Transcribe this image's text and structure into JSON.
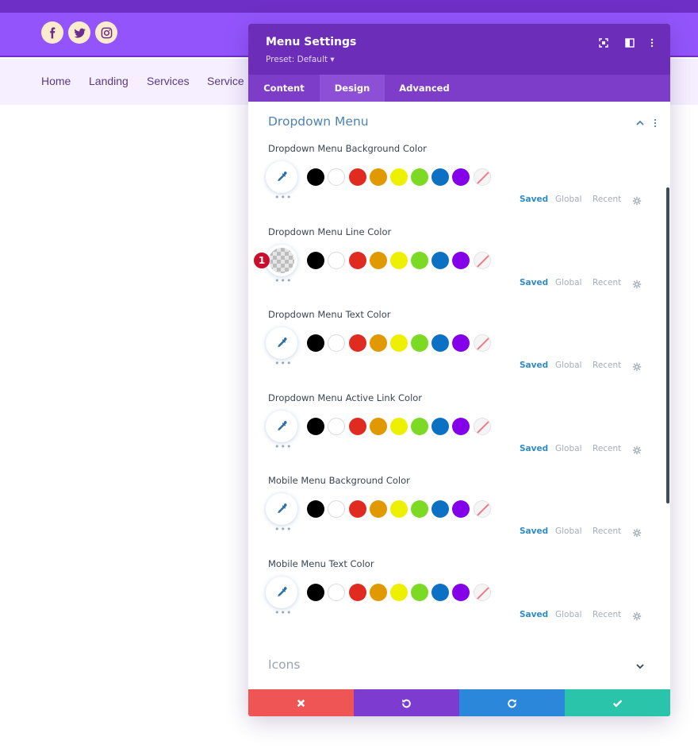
{
  "site": {
    "nav": [
      "Home",
      "Landing",
      "Services",
      "Service"
    ],
    "social_icons": [
      "facebook-icon",
      "twitter-icon",
      "instagram-icon"
    ]
  },
  "modal": {
    "title": "Menu Settings",
    "preset": "Preset: Default ▾",
    "tabs": [
      "Content",
      "Design",
      "Advanced"
    ],
    "active_tab": "Design",
    "section_title": "Dropdown Menu",
    "collapsed_section": "Icons",
    "fields": [
      {
        "label": "Dropdown Menu Background Color",
        "value": "",
        "marker": ""
      },
      {
        "label": "Dropdown Menu Line Color",
        "value": "transparent",
        "marker": "1"
      },
      {
        "label": "Dropdown Menu Text Color",
        "value": "",
        "marker": ""
      },
      {
        "label": "Dropdown Menu Active Link Color",
        "value": "",
        "marker": ""
      },
      {
        "label": "Mobile Menu Background Color",
        "value": "",
        "marker": ""
      },
      {
        "label": "Mobile Menu Text Color",
        "value": "",
        "marker": ""
      }
    ],
    "palette": [
      "#000000",
      "#ffffff",
      "#e02b20",
      "#e09900",
      "#edf000",
      "#7cda24",
      "#0c71c3",
      "#8300e9",
      "none"
    ],
    "palette_options": {
      "saved": "Saved",
      "global": "Global",
      "recent": "Recent"
    },
    "more_dots": "•••",
    "footer_buttons": [
      "cancel",
      "undo",
      "redo",
      "save"
    ]
  },
  "colors": {
    "accent_purple": "#6c2eb9",
    "cancel": "#ef5555",
    "undo": "#7e3bd0",
    "redo": "#2b87da",
    "save": "#29c4a9"
  }
}
